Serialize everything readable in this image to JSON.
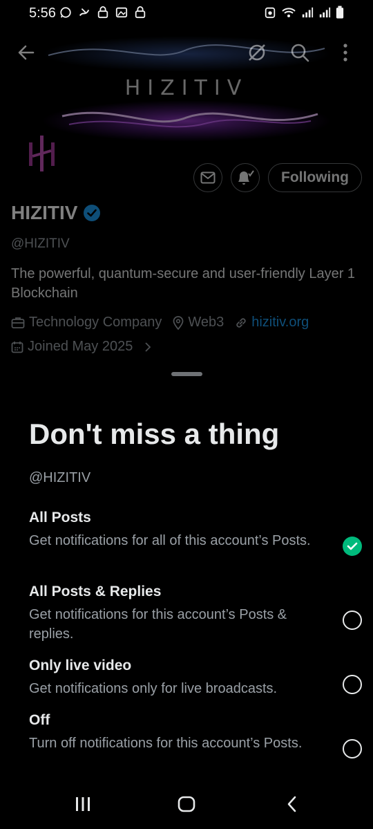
{
  "status_bar": {
    "time": "5:56",
    "left_icons": [
      "whatsapp-icon",
      "x-notification-icon",
      "lock-icon",
      "image-icon",
      "lock-icon"
    ],
    "right_icons": [
      "alarm-icon",
      "wifi-icon",
      "signal-icon",
      "signal-icon",
      "battery-icon"
    ]
  },
  "banner": {
    "wordmark": "HIZITIV"
  },
  "profile": {
    "name": "HIZITIV",
    "handle": "@HIZITIV",
    "bio": "The powerful, quantum-secure and user-friendly Layer 1 Blockchain",
    "category": "Technology Company",
    "location": "Web3",
    "website": "hizitiv.org",
    "joined": "Joined May 2025",
    "following_label": "Following"
  },
  "sheet": {
    "title": "Don't miss a thing",
    "handle": "@HIZITIV",
    "options": [
      {
        "title": "All Posts",
        "description": "Get notifications for all of this account’s Posts.",
        "selected": true
      },
      {
        "title": "All Posts & Replies",
        "description": "Get notifications for this account’s Posts & replies.",
        "selected": false
      },
      {
        "title": "Only live video",
        "description": "Get notifications only for live broadcasts.",
        "selected": false
      },
      {
        "title": "Off",
        "description": "Turn off notifications for this account’s Posts.",
        "selected": false
      }
    ]
  },
  "colors": {
    "accent": "#1d9bf0",
    "check": "#00ba7c",
    "verified": "#1d9bf0",
    "background": "#000000"
  }
}
